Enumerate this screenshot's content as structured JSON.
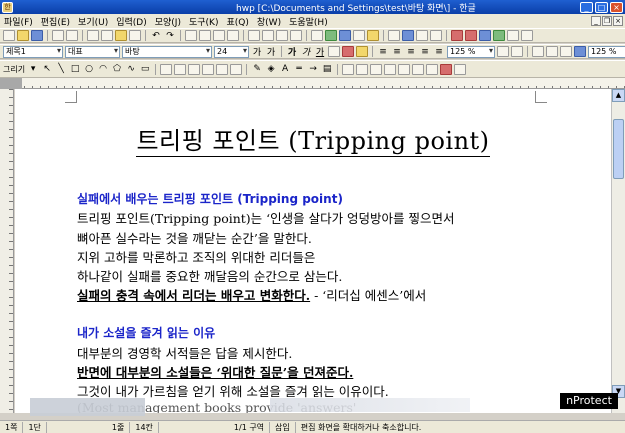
{
  "window": {
    "title": "hwp [C:\\Documents and Settings\\test\\바탕 화면\\] - 한글",
    "app_icon": "한"
  },
  "menu": [
    "파일(F)",
    "편집(E)",
    "보기(U)",
    "입력(D)",
    "모양(J)",
    "도구(K)",
    "표(Q)",
    "창(W)",
    "도움말(H)"
  ],
  "toolbar2": {
    "style": "제목1",
    "font_type": "대표",
    "font": "바탕",
    "size": "24",
    "line_spacing": "125 %",
    "zoom": "125 %"
  },
  "toolbar3": {
    "draw_label": "그리기"
  },
  "document": {
    "title": "트리핑 포인트 (Tripping point)",
    "section1_heading": "실패에서 배우는 트리핑 포인트 (Tripping point)",
    "lines1": [
      "트리핑 포인트(Tripping point)는 ‘인생을 살다가 엉덩방아를 찧으면서",
      "뼈아픈 실수라는 것을 깨닫는 순간’을 말한다.",
      "지위 고하를 막론하고 조직의 위대한 리더들은",
      "하나같이 실패를 중요한 깨달음의 순간으로 삼는다."
    ],
    "emphasis1": "실패의 충격 속에서 리더는 배우고 변화한다.",
    "source1": " - ‘리더십 에센스’에서",
    "section2_heading": "내가 소설을 즐겨 읽는 이유",
    "line2a": "대부분의 경영학 서적들은 답을 제시한다.",
    "emphasis2": "반면에 대부분의 소설들은 ‘위대한 질문’을 던져준다.",
    "line2b": "그것이 내가 가르침을 얻기 위해 소설을 즐겨 읽는 이유이다.",
    "line2c": "(Most management books provide 'answers'"
  },
  "status": {
    "page": "1쪽",
    "section": "1단",
    "line": "1줄",
    "column": "14칸",
    "pages": "1/1 구역",
    "mode": "삽입",
    "message": "편집 화면을 확대하거나 축소합니다."
  },
  "overlay": {
    "badge": "nProtect"
  }
}
